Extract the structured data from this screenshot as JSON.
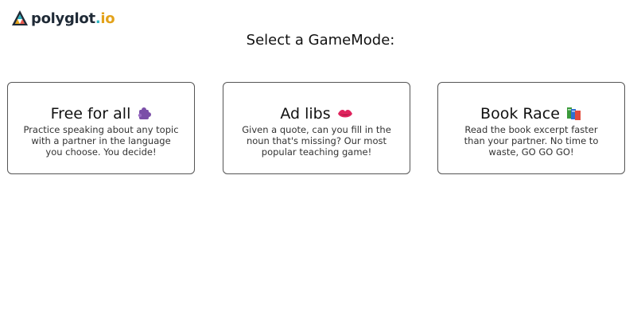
{
  "logo": {
    "text_main": "polygl",
    "text_o": "o",
    "text_t": "t",
    "text_dot": ".",
    "text_io": "io"
  },
  "page": {
    "title": "Select a GameMode:"
  },
  "modes": [
    {
      "title": "Free for all",
      "icon": "purple-puzzle-icon",
      "description": "Practice speaking about any topic with a partner in the language you choose. You decide!"
    },
    {
      "title": "Ad libs",
      "icon": "lips-icon",
      "description": "Given a quote, can you fill in the noun that's missing? Our most popular teaching game!"
    },
    {
      "title": "Book Race",
      "icon": "books-icon",
      "description": "Read the book excerpt faster than your partner. No time to waste, GO GO GO!"
    }
  ],
  "colors": {
    "logo_dark": "#1f2a36",
    "logo_teal": "#2bb3c0",
    "logo_gold": "#e3a21a",
    "card_border": "#555555"
  }
}
